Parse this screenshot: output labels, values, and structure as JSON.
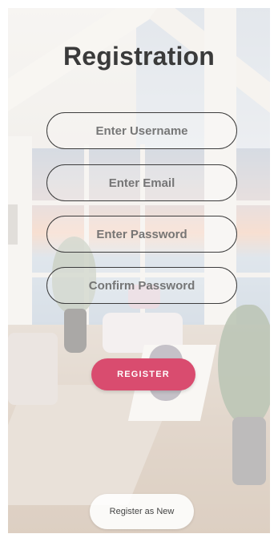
{
  "screen": {
    "title": "Registration"
  },
  "form": {
    "username_placeholder": "Enter Username",
    "email_placeholder": "Enter Email",
    "password_placeholder": "Enter Password",
    "confirm_password_placeholder": "Confirm Password",
    "register_label": "REGISTER",
    "register_new_label": "Register as New"
  },
  "colors": {
    "accent": "#d94c6f",
    "title_text": "#3a3a3a",
    "field_border": "#3d3d3d"
  }
}
